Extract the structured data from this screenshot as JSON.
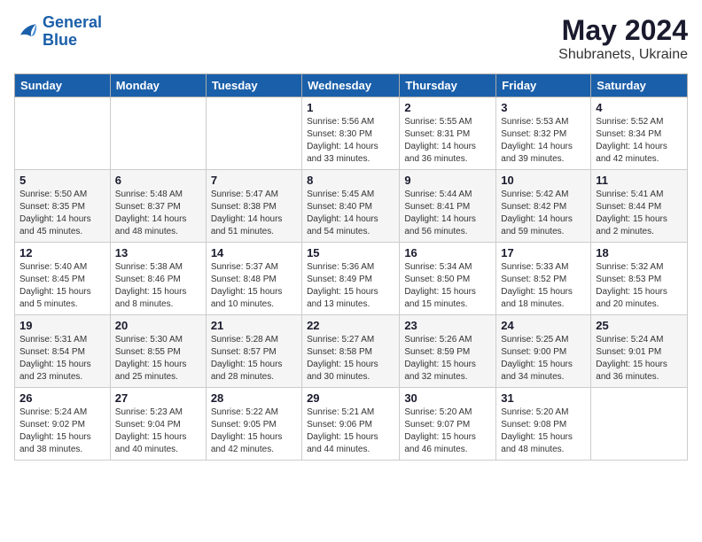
{
  "header": {
    "logo_line1": "General",
    "logo_line2": "Blue",
    "month": "May 2024",
    "location": "Shubranets, Ukraine"
  },
  "weekdays": [
    "Sunday",
    "Monday",
    "Tuesday",
    "Wednesday",
    "Thursday",
    "Friday",
    "Saturday"
  ],
  "weeks": [
    [
      null,
      null,
      null,
      {
        "day": "1",
        "sunrise": "5:56 AM",
        "sunset": "8:30 PM",
        "daylight": "14 hours and 33 minutes."
      },
      {
        "day": "2",
        "sunrise": "5:55 AM",
        "sunset": "8:31 PM",
        "daylight": "14 hours and 36 minutes."
      },
      {
        "day": "3",
        "sunrise": "5:53 AM",
        "sunset": "8:32 PM",
        "daylight": "14 hours and 39 minutes."
      },
      {
        "day": "4",
        "sunrise": "5:52 AM",
        "sunset": "8:34 PM",
        "daylight": "14 hours and 42 minutes."
      }
    ],
    [
      {
        "day": "5",
        "sunrise": "5:50 AM",
        "sunset": "8:35 PM",
        "daylight": "14 hours and 45 minutes."
      },
      {
        "day": "6",
        "sunrise": "5:48 AM",
        "sunset": "8:37 PM",
        "daylight": "14 hours and 48 minutes."
      },
      {
        "day": "7",
        "sunrise": "5:47 AM",
        "sunset": "8:38 PM",
        "daylight": "14 hours and 51 minutes."
      },
      {
        "day": "8",
        "sunrise": "5:45 AM",
        "sunset": "8:40 PM",
        "daylight": "14 hours and 54 minutes."
      },
      {
        "day": "9",
        "sunrise": "5:44 AM",
        "sunset": "8:41 PM",
        "daylight": "14 hours and 56 minutes."
      },
      {
        "day": "10",
        "sunrise": "5:42 AM",
        "sunset": "8:42 PM",
        "daylight": "14 hours and 59 minutes."
      },
      {
        "day": "11",
        "sunrise": "5:41 AM",
        "sunset": "8:44 PM",
        "daylight": "15 hours and 2 minutes."
      }
    ],
    [
      {
        "day": "12",
        "sunrise": "5:40 AM",
        "sunset": "8:45 PM",
        "daylight": "15 hours and 5 minutes."
      },
      {
        "day": "13",
        "sunrise": "5:38 AM",
        "sunset": "8:46 PM",
        "daylight": "15 hours and 8 minutes."
      },
      {
        "day": "14",
        "sunrise": "5:37 AM",
        "sunset": "8:48 PM",
        "daylight": "15 hours and 10 minutes."
      },
      {
        "day": "15",
        "sunrise": "5:36 AM",
        "sunset": "8:49 PM",
        "daylight": "15 hours and 13 minutes."
      },
      {
        "day": "16",
        "sunrise": "5:34 AM",
        "sunset": "8:50 PM",
        "daylight": "15 hours and 15 minutes."
      },
      {
        "day": "17",
        "sunrise": "5:33 AM",
        "sunset": "8:52 PM",
        "daylight": "15 hours and 18 minutes."
      },
      {
        "day": "18",
        "sunrise": "5:32 AM",
        "sunset": "8:53 PM",
        "daylight": "15 hours and 20 minutes."
      }
    ],
    [
      {
        "day": "19",
        "sunrise": "5:31 AM",
        "sunset": "8:54 PM",
        "daylight": "15 hours and 23 minutes."
      },
      {
        "day": "20",
        "sunrise": "5:30 AM",
        "sunset": "8:55 PM",
        "daylight": "15 hours and 25 minutes."
      },
      {
        "day": "21",
        "sunrise": "5:28 AM",
        "sunset": "8:57 PM",
        "daylight": "15 hours and 28 minutes."
      },
      {
        "day": "22",
        "sunrise": "5:27 AM",
        "sunset": "8:58 PM",
        "daylight": "15 hours and 30 minutes."
      },
      {
        "day": "23",
        "sunrise": "5:26 AM",
        "sunset": "8:59 PM",
        "daylight": "15 hours and 32 minutes."
      },
      {
        "day": "24",
        "sunrise": "5:25 AM",
        "sunset": "9:00 PM",
        "daylight": "15 hours and 34 minutes."
      },
      {
        "day": "25",
        "sunrise": "5:24 AM",
        "sunset": "9:01 PM",
        "daylight": "15 hours and 36 minutes."
      }
    ],
    [
      {
        "day": "26",
        "sunrise": "5:24 AM",
        "sunset": "9:02 PM",
        "daylight": "15 hours and 38 minutes."
      },
      {
        "day": "27",
        "sunrise": "5:23 AM",
        "sunset": "9:04 PM",
        "daylight": "15 hours and 40 minutes."
      },
      {
        "day": "28",
        "sunrise": "5:22 AM",
        "sunset": "9:05 PM",
        "daylight": "15 hours and 42 minutes."
      },
      {
        "day": "29",
        "sunrise": "5:21 AM",
        "sunset": "9:06 PM",
        "daylight": "15 hours and 44 minutes."
      },
      {
        "day": "30",
        "sunrise": "5:20 AM",
        "sunset": "9:07 PM",
        "daylight": "15 hours and 46 minutes."
      },
      {
        "day": "31",
        "sunrise": "5:20 AM",
        "sunset": "9:08 PM",
        "daylight": "15 hours and 48 minutes."
      },
      null
    ]
  ]
}
